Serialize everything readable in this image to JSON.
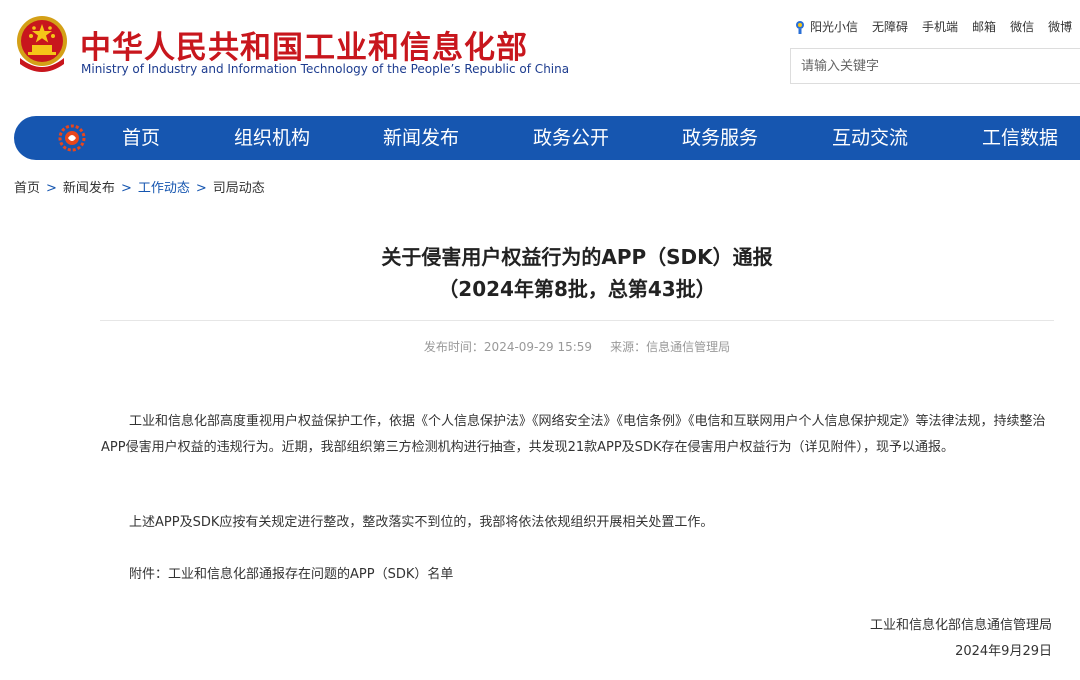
{
  "header": {
    "site_title": "中华人民共和国工业和信息化部",
    "site_subtitle": "Ministry of Industry and Information Technology of the People’s Republic of China",
    "top_links": [
      "阳光小信",
      "无障碍",
      "手机端",
      "邮箱",
      "微信",
      "微博"
    ],
    "search": {
      "placeholder": "请输入关键字"
    }
  },
  "nav": {
    "items": [
      "首页",
      "组织机构",
      "新闻发布",
      "政务公开",
      "政务服务",
      "互动交流",
      "工信数据"
    ]
  },
  "breadcrumb": [
    "首页",
    "新闻发布",
    "工作动态",
    "司局动态"
  ],
  "article": {
    "title_line1": "关于侵害用户权益行为的APP（SDK）通报",
    "title_line2": "（2024年第8批，总第43批）",
    "publish_label": "发布时间：",
    "publish_time": "2024-09-29 15:59",
    "source_label": "来源：",
    "source": "信息通信管理局",
    "paragraphs": [
      "工业和信息化部高度重视用户权益保护工作，依据《个人信息保护法》《网络安全法》《电信条例》《电信和互联网用户个人信息保护规定》等法律法规，持续整治APP侵害用户权益的违规行为。近期，我部组织第三方检测机构进行抽查，共发现21款APP及SDK存在侵害用户权益行为（详见附件），现予以通报。",
      "上述APP及SDK应按有关规定进行整改，整改落实不到位的，我部将依法依规组织开展相关处置工作。",
      "附件：工业和信息化部通报存在问题的APP（SDK）名单"
    ],
    "signature": "工业和信息化部信息通信管理局",
    "date": "2024年9月29日"
  },
  "colors": {
    "brand_red": "#c8161d",
    "nav_blue": "#1656b0",
    "subtitle_blue": "#1d3c8f"
  }
}
